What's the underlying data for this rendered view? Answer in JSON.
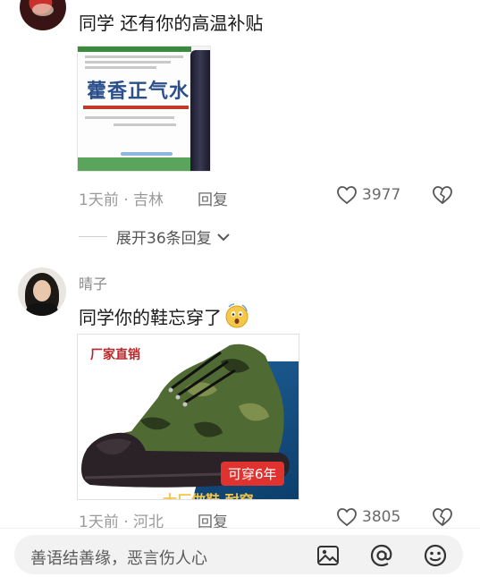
{
  "comments": [
    {
      "text": "同学 还有你的高温补贴",
      "image_label": "藿香正气水",
      "meta": "1天前 · 吉林",
      "reply_label": "回复",
      "likes": "3977"
    },
    {
      "username": "晴子",
      "text": "同学你的鞋忘穿了",
      "image_tag": "厂家直销",
      "image_badge": "可穿6年",
      "image_bottom_text": "大厂做鞋 耐穿",
      "meta": "1天前 · 河北",
      "reply_label": "回复",
      "likes": "3805"
    }
  ],
  "expand_replies": "展开36条回复",
  "composer": {
    "placeholder": "善语结善缘，恶言伤人心",
    "icons": [
      "image-icon",
      "at-icon",
      "emoji-icon"
    ]
  },
  "colors": {
    "text": "#1a1a1a",
    "meta": "#9a9a9a",
    "badge_red": "#e0322f"
  }
}
